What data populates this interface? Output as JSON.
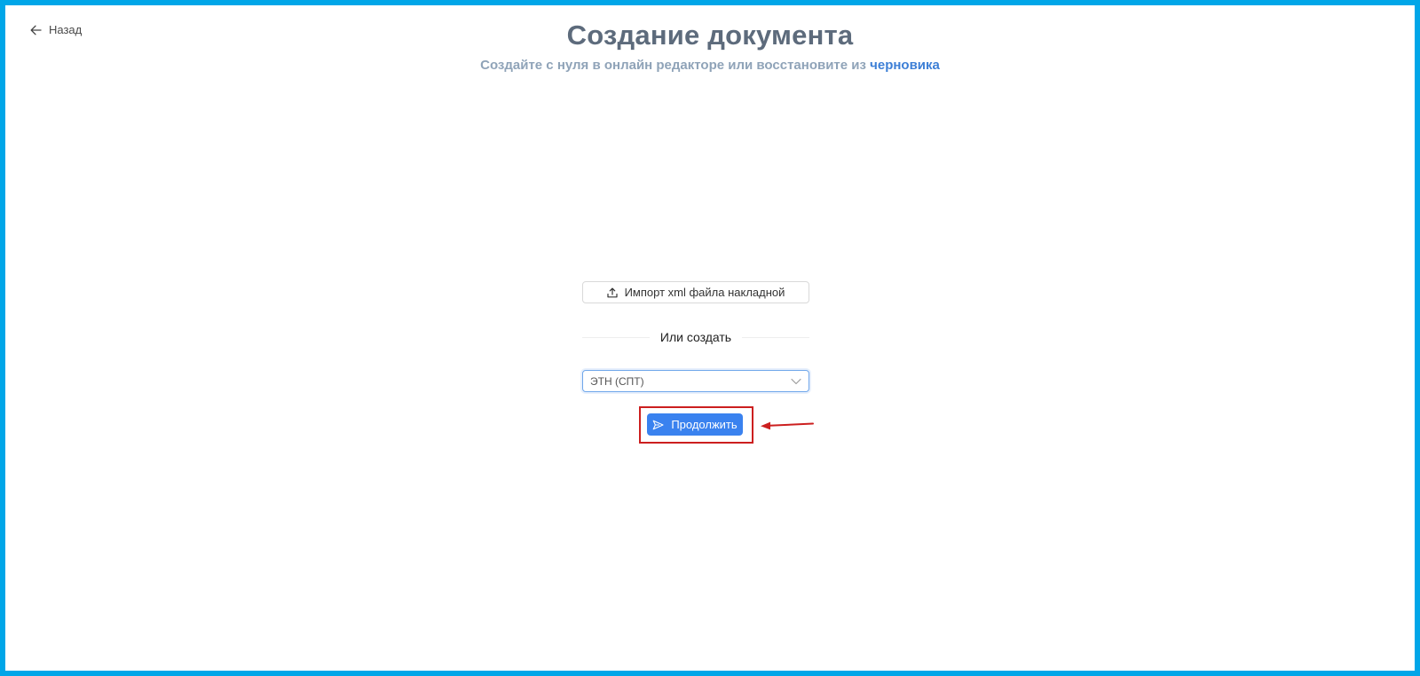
{
  "nav": {
    "back_label": "Назад",
    "back_icon": "arrow-left-icon"
  },
  "header": {
    "title": "Создание документа",
    "subtitle_text": "Создайте с нуля в онлайн редакторе или восстановите из",
    "subtitle_link": "черновика"
  },
  "import": {
    "button_label": "Импорт xml файла накладной",
    "icon": "upload-icon"
  },
  "divider": {
    "label": "Или создать"
  },
  "document_type": {
    "selected_value": "ЭТН (СПТ)",
    "icon": "chevron-down-icon"
  },
  "actions": {
    "continue_label": "Продолжить",
    "continue_icon": "send-icon"
  },
  "annotation": {
    "highlight_color": "#cc1f1f",
    "arrow_color": "#cc1f1f"
  },
  "colors": {
    "frame_border": "#00a6e8",
    "primary": "#3a82ef",
    "title": "#5d6b7c",
    "subtitle": "#8fa3b8",
    "link": "#3d7fd6"
  }
}
